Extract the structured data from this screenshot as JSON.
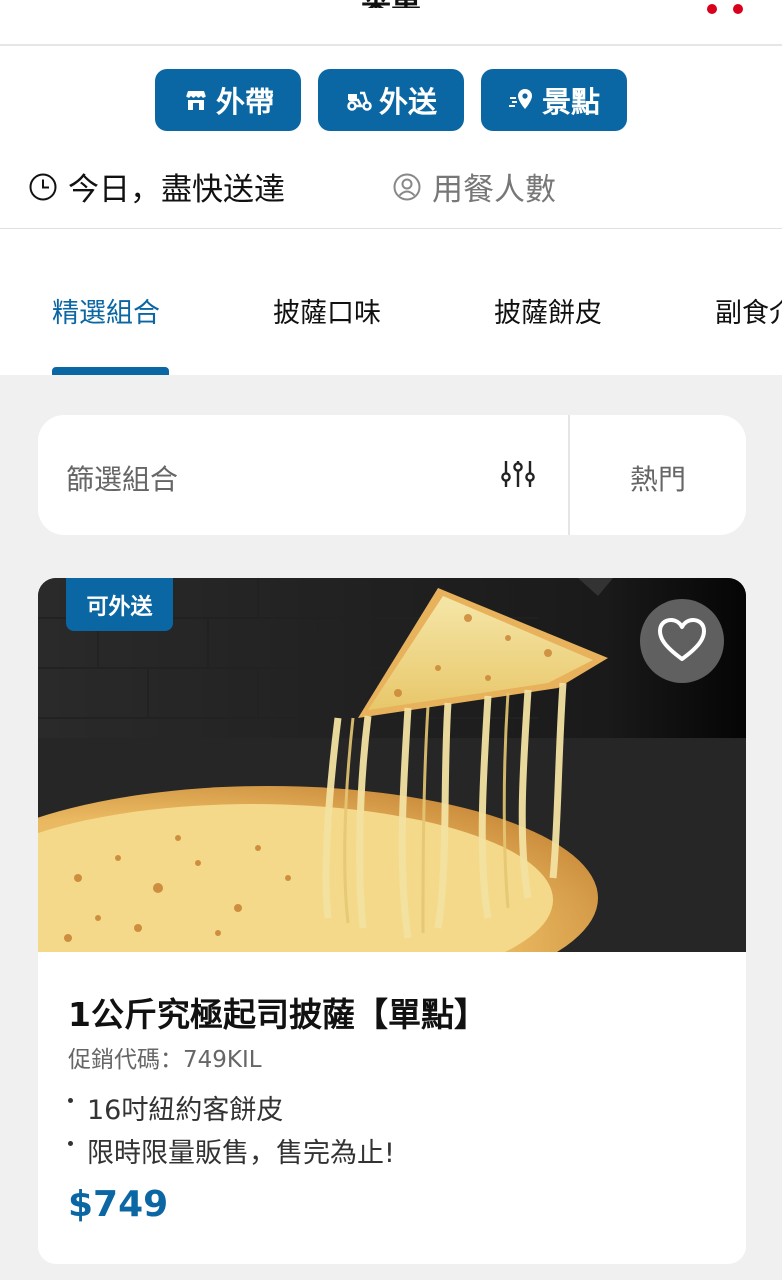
{
  "header": {
    "title": "菜單"
  },
  "order_modes": [
    {
      "label": "外帶",
      "icon": "store-icon"
    },
    {
      "label": "外送",
      "icon": "scooter-icon"
    },
    {
      "label": "景點",
      "icon": "location-pin-icon"
    }
  ],
  "delivery": {
    "time_label": "今日，盡快送達",
    "time_icon": "clock-icon",
    "diners_label": "用餐人數",
    "diners_icon": "person-icon"
  },
  "category_tabs": [
    {
      "label": "精選組合",
      "active": true
    },
    {
      "label": "披薩口味",
      "active": false
    },
    {
      "label": "披薩餅皮",
      "active": false
    },
    {
      "label": "副食介",
      "active": false
    }
  ],
  "filter": {
    "label": "篩選組合",
    "icon": "filter-sliders-icon",
    "sort_label": "熱門"
  },
  "product": {
    "badge": "可外送",
    "name": "1公斤究極起司披薩【單點】",
    "promo_code": "促銷代碼：749KIL",
    "features": [
      "16吋紐約客餅皮",
      "限時限量販售，售完為止!"
    ],
    "price": "$749",
    "favorite_icon": "heart-icon"
  },
  "colors": {
    "brand_blue": "#0a67a3",
    "accent_red": "#d9001b",
    "background": "#f0f0f0"
  }
}
